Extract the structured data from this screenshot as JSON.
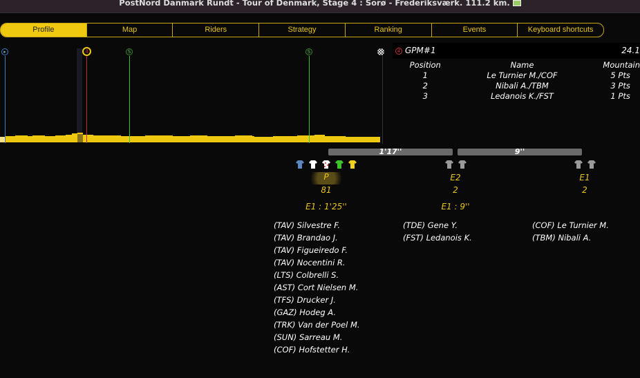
{
  "window": {
    "title": "PostNord Danmark Rundt - Tour of Denmark, Stage 4 : Sorø - Frederiksværk. 111.2 km."
  },
  "tabs": [
    {
      "label": "Profile",
      "active": true
    },
    {
      "label": "Map"
    },
    {
      "label": "Riders"
    },
    {
      "label": "Strategy"
    },
    {
      "label": "Ranking"
    },
    {
      "label": "Events"
    },
    {
      "label": "Keyboard shortcuts"
    }
  ],
  "profile": {
    "markers": [
      {
        "icon": "start-icon",
        "label": "▸"
      },
      {
        "icon": "mountain-sprint-icon",
        "label": "4"
      },
      {
        "icon": "sprint-icon",
        "label": "S"
      },
      {
        "icon": "sprint-icon",
        "label": "S"
      },
      {
        "icon": "finish-flag-icon"
      }
    ],
    "colors": {
      "profile": "#eec90f",
      "mountain": "#c0263a",
      "sprint": "#35c52a",
      "start": "#3a7ec0"
    }
  },
  "gpm": {
    "category": "4",
    "title": "GPM#1",
    "distance": "24.1",
    "columns": [
      "Position",
      "Name",
      "Mountain"
    ],
    "rows": [
      [
        "1",
        "Le Turnier M./COF",
        "5 Pts"
      ],
      [
        "2",
        "Nibali A./TBM",
        "3 Pts"
      ],
      [
        "3",
        "Ledanois K./FST",
        "1 Pts"
      ]
    ]
  },
  "gaps": [
    "1'17''",
    "9''"
  ],
  "groups": [
    {
      "label": "P",
      "count": "81",
      "delay": "E1 : 1'25''",
      "jerseys": [
        "#5b86c0",
        "#ffffff",
        "polka",
        "#3ec42a",
        "#f2d21a"
      ],
      "riders": [
        "(TAV) Silvestre F.",
        "(TAV) Brandao J.",
        "(TAV) Figueiredo F.",
        "(TAV) Nocentini R.",
        "(LTS) Colbrelli S.",
        "(AST) Cort Nielsen M.",
        "(TFS) Drucker J.",
        "(GAZ) Hodeg A.",
        "(TRK) Van der Poel M.",
        "(SUN) Sarreau M.",
        "(COF) Hofstetter H."
      ]
    },
    {
      "label": "E2",
      "count": "2",
      "delay": "E1 : 9''",
      "jerseys": [
        "#9a9a9a",
        "#9a9a9a"
      ],
      "riders": [
        "(TDE) Gene Y.",
        "(FST) Ledanois K."
      ]
    },
    {
      "label": "E1",
      "count": "2",
      "delay": "",
      "jerseys": [
        "#9a9a9a",
        "#9a9a9a"
      ],
      "riders": [
        "(COF) Le Turnier M.",
        "(TBM) Nibali A."
      ]
    }
  ]
}
